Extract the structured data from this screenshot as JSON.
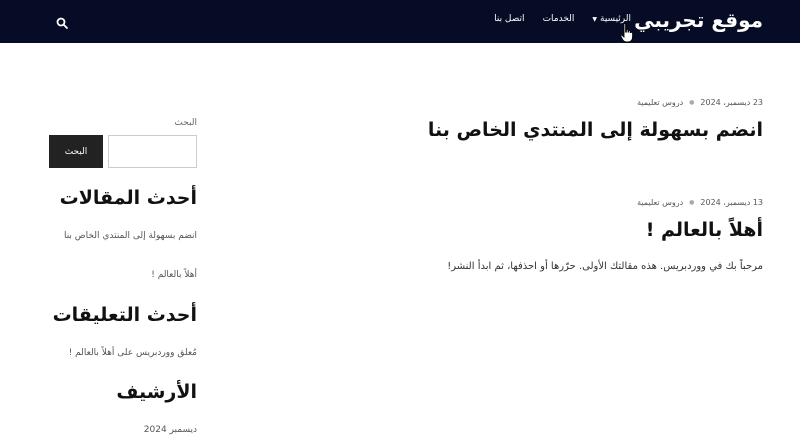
{
  "header": {
    "site_title": "موقع تجريبي",
    "nav": [
      {
        "label": "الرئيسية",
        "has_dropdown": true
      },
      {
        "label": "الخدمات",
        "has_dropdown": false
      },
      {
        "label": "اتصل بنا",
        "has_dropdown": false
      }
    ],
    "search_icon": "search-icon"
  },
  "posts": [
    {
      "date": "23 ديسمبر، 2024",
      "category": "دروس تعليمية",
      "title": "انضم بسهولة إلى المنتدي الخاص بنا",
      "excerpt": ""
    },
    {
      "date": "13 ديسمبر، 2024",
      "category": "دروس تعليمية",
      "title": "أهلاً بالعالم !",
      "excerpt": "مرحباً بك في ووردبريس. هذه مقالتك الأولى. حرّرها أو احذفها، ثم ابدأ النشر!"
    }
  ],
  "sidebar": {
    "search_label": "البحث",
    "search_placeholder": "",
    "search_button": "البحث",
    "recent_posts_title": "أحدث المقالات",
    "recent_posts": [
      "انضم بسهولة إلى المنتدي الخاص بنا",
      "أهلاً بالعالم !"
    ],
    "recent_comments_title": "أحدث التعليقات",
    "recent_comments": [
      "مُعلق ووردبريس على أهلاً بالعالم !"
    ],
    "archive_title": "الأرشيف",
    "archives": [
      "ديسمبر 2024"
    ]
  },
  "colors": {
    "header_bg": "#060c25",
    "button_bg": "#222222"
  }
}
